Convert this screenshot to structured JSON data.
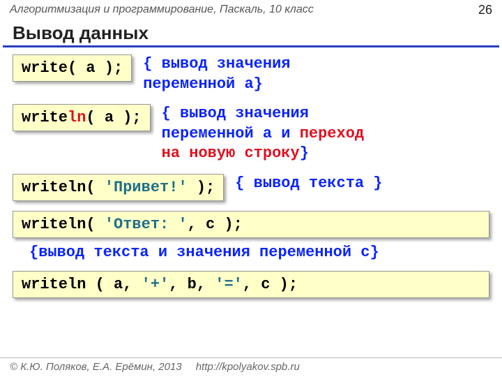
{
  "header": {
    "subject": "Алгоритмизация и программирование, Паскаль, 10 класс",
    "page": "26"
  },
  "title": "Вывод данных",
  "blocks": {
    "b1_code": "write( a );",
    "b1_exp_l1": "{ вывод значения",
    "b1_exp_l2": "переменной a}",
    "b2_pre": "write",
    "b2_ln": "ln",
    "b2_post": "( a );",
    "b2_exp_l1": "{ вывод значения",
    "b2_exp_l2a": "переменной a и ",
    "b2_exp_l2b": "переход",
    "b2_exp_l3a": "на новую строку",
    "b2_exp_l3b": "}",
    "b3_pre": "writeln( ",
    "b3_str": "'Привет!'",
    "b3_post": " );",
    "b3_exp": "{ вывод текста }",
    "b4_pre": "writeln( ",
    "b4_str": "'Ответ: '",
    "b4_post": ", c );",
    "b4_exp": "{вывод текста и значения переменной c}",
    "b5_pre": "writeln ( a, ",
    "b5_s1": "'+'",
    "b5_mid": ", b, ",
    "b5_s2": "'='",
    "b5_post": ", c );"
  },
  "footer": {
    "copyright": "© К.Ю. Поляков, Е.А. Ерёмин, 2013",
    "url": "http://kpolyakov.spb.ru"
  }
}
